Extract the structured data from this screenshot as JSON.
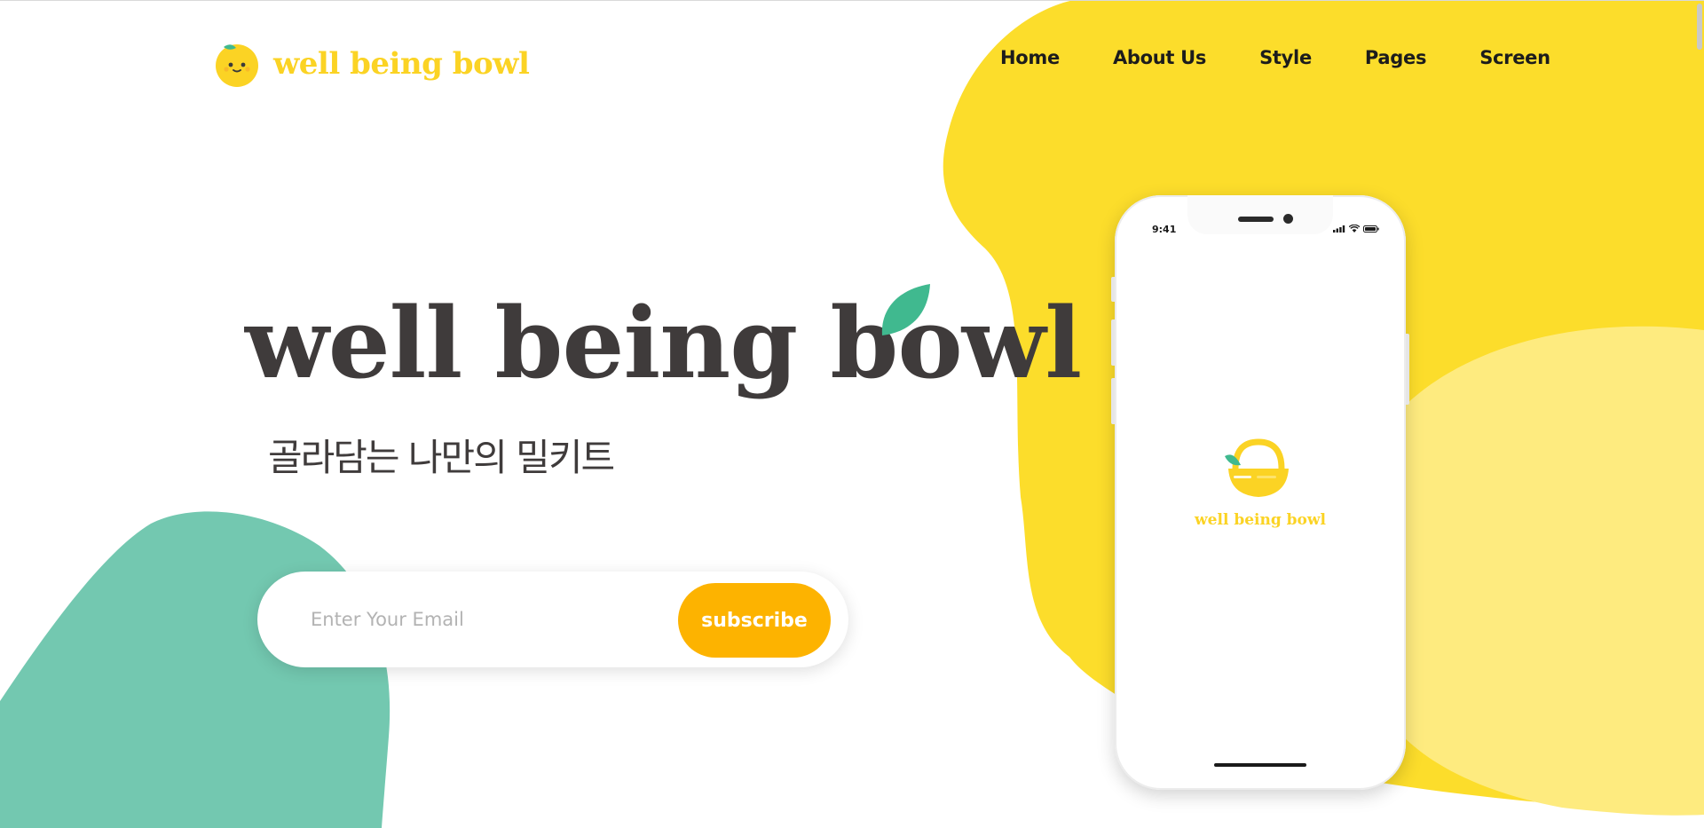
{
  "brand": {
    "name": "well being bowl",
    "icon": "smiley-lemon-icon"
  },
  "nav": {
    "items": [
      {
        "label": "Home"
      },
      {
        "label": "About Us"
      },
      {
        "label": "Style"
      },
      {
        "label": "Pages"
      },
      {
        "label": "Screen"
      }
    ]
  },
  "hero": {
    "title": "well being bowl",
    "subtitle": "골라담는 나만의 밀키트",
    "accent_icon": "leaf-icon"
  },
  "subscribe": {
    "placeholder": "Enter Your Email",
    "value": "",
    "button_label": "subscribe"
  },
  "phone": {
    "status_time": "9:41",
    "splash_text": "well being bowl",
    "splash_icon": "basket-icon",
    "status_icons": [
      "signal-icon",
      "wifi-icon",
      "battery-icon"
    ]
  },
  "colors": {
    "brand_yellow": "#fbd324",
    "blob_yellow": "#fcdd2b",
    "blob_light_yellow": "#feeb7f",
    "blob_green": "#73c8b0",
    "accent_orange": "#fdb300",
    "leaf_green": "#40b98f",
    "text_dark": "#3f3b3b"
  }
}
